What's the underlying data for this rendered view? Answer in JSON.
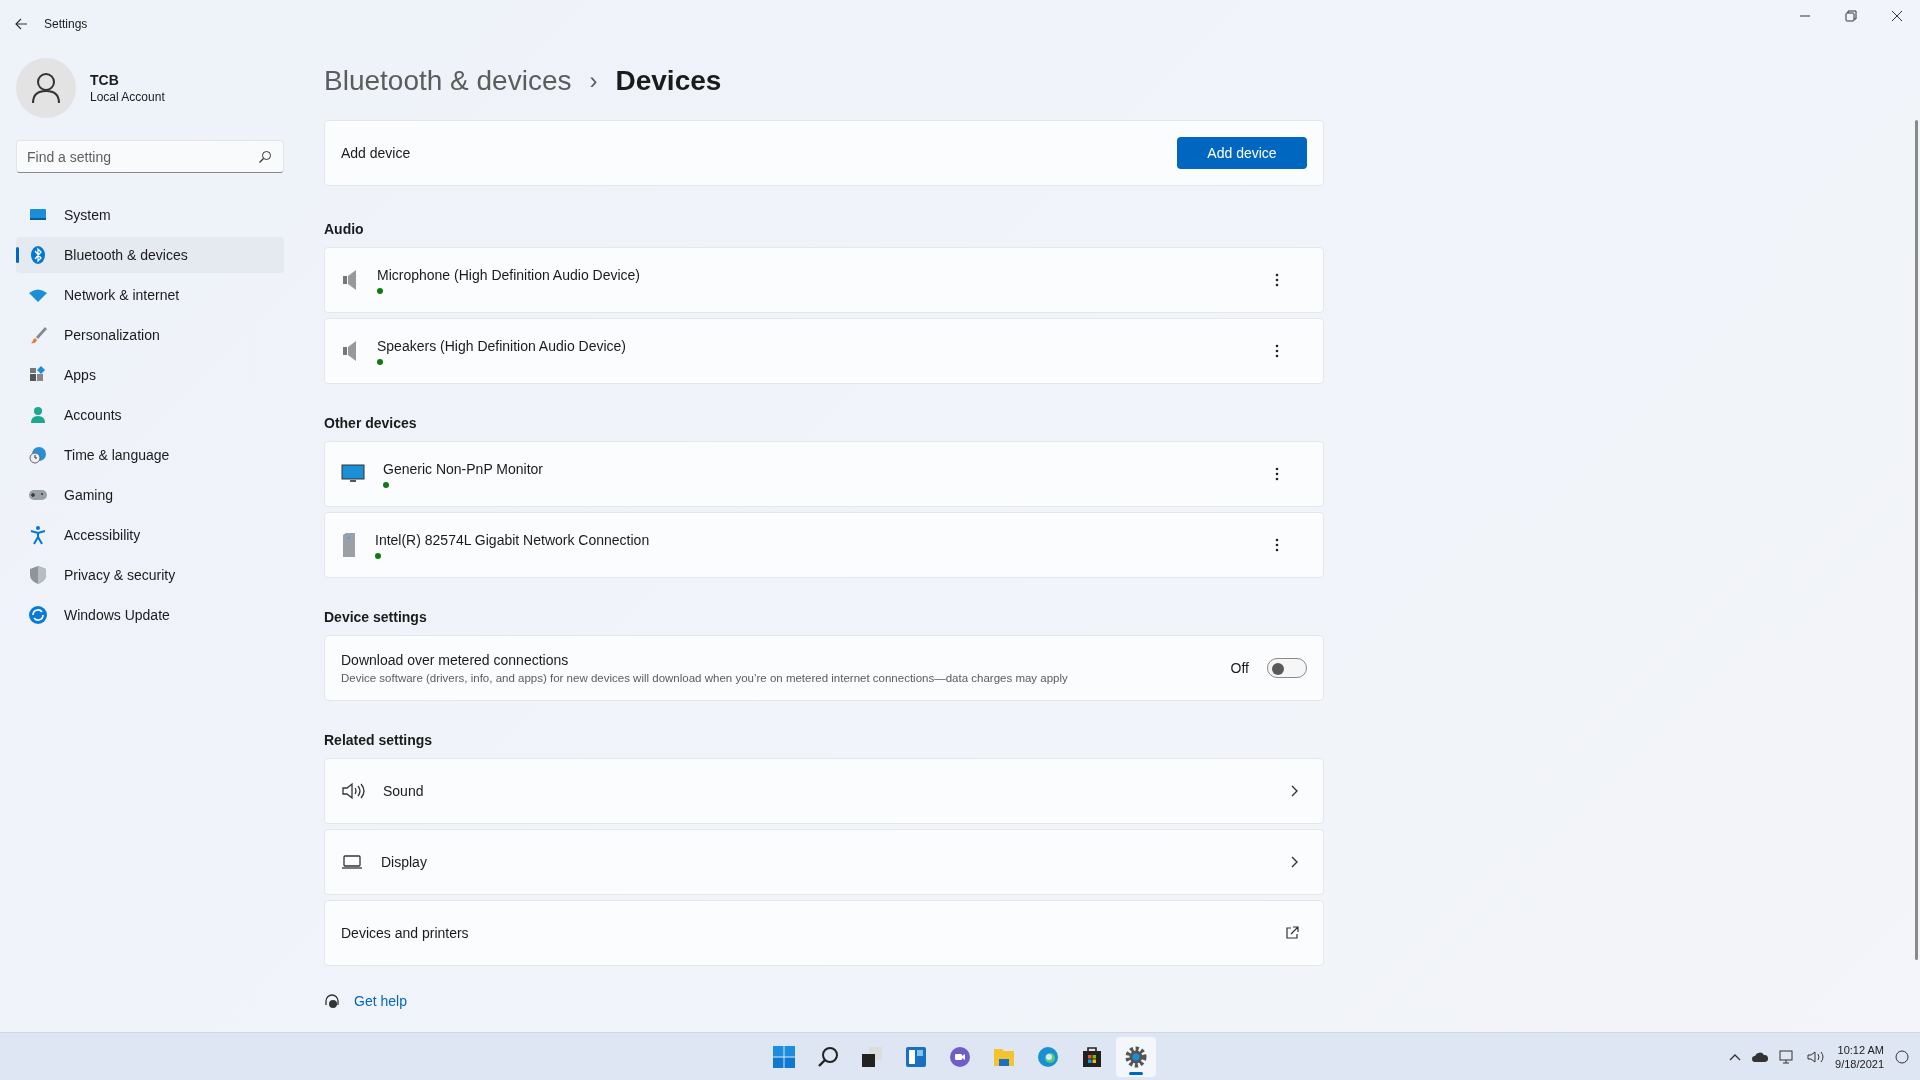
{
  "window": {
    "title": "Settings"
  },
  "user": {
    "name": "TCB",
    "account": "Local Account"
  },
  "search": {
    "placeholder": "Find a setting"
  },
  "nav": [
    {
      "label": "System",
      "selected": false
    },
    {
      "label": "Bluetooth & devices",
      "selected": true
    },
    {
      "label": "Network & internet",
      "selected": false
    },
    {
      "label": "Personalization",
      "selected": false
    },
    {
      "label": "Apps",
      "selected": false
    },
    {
      "label": "Accounts",
      "selected": false
    },
    {
      "label": "Time & language",
      "selected": false
    },
    {
      "label": "Gaming",
      "selected": false
    },
    {
      "label": "Accessibility",
      "selected": false
    },
    {
      "label": "Privacy & security",
      "selected": false
    },
    {
      "label": "Windows Update",
      "selected": false
    }
  ],
  "breadcrumb": {
    "parent": "Bluetooth & devices",
    "separator": "›",
    "current": "Devices"
  },
  "add_device": {
    "label": "Add device",
    "button": "Add device"
  },
  "sections": [
    {
      "heading": "Audio",
      "devices": [
        {
          "name": "Microphone (High Definition Audio Device)",
          "kind": "speaker",
          "connected": true
        },
        {
          "name": "Speakers (High Definition Audio Device)",
          "kind": "speaker",
          "connected": true
        }
      ]
    },
    {
      "heading": "Other devices",
      "devices": [
        {
          "name": "Generic Non-PnP Monitor",
          "kind": "monitor",
          "connected": true
        },
        {
          "name": "Intel(R) 82574L Gigabit Network Connection",
          "kind": "tower",
          "connected": true
        }
      ]
    }
  ],
  "device_settings": {
    "heading": "Device settings",
    "title": "Download over metered connections",
    "description": "Device software (drivers, info, and apps) for new devices will download when you’re on metered internet connections—data charges may apply",
    "state_label": "Off",
    "on": false
  },
  "related": {
    "heading": "Related settings",
    "items": [
      {
        "label": "Sound",
        "kind": "sound"
      },
      {
        "label": "Display",
        "kind": "display"
      },
      {
        "label": "Devices and printers",
        "kind": "external"
      }
    ]
  },
  "help": {
    "label": "Get help"
  },
  "taskbar": {
    "apps": [
      {
        "selected": false
      },
      {
        "selected": false
      },
      {
        "selected": false
      },
      {
        "selected": false
      },
      {
        "selected": false
      },
      {
        "selected": false
      },
      {
        "selected": false
      },
      {
        "selected": false
      },
      {
        "selected": true
      }
    ],
    "time": "10:12 AM",
    "date": "9/18/2021"
  }
}
